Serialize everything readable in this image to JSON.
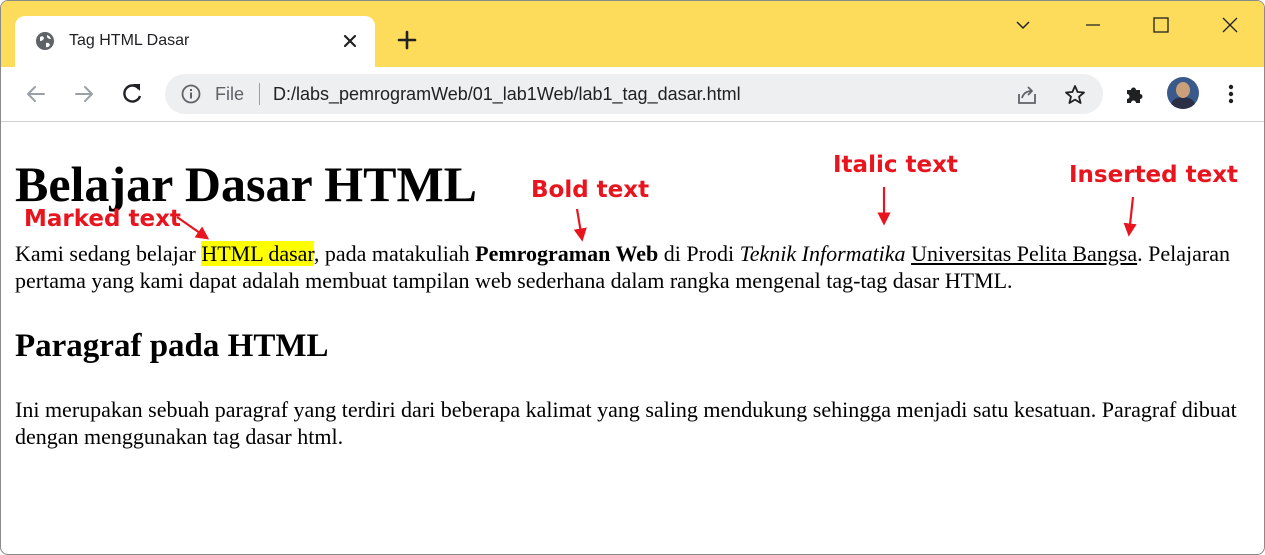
{
  "browser": {
    "tab_title": "Tag HTML Dasar",
    "file_label": "File",
    "url": "D:/labs_pemrogramWeb/01_lab1Web/lab1_tag_dasar.html",
    "titlebar_color": "#fcdc5a"
  },
  "page": {
    "heading1": "Belajar Dasar HTML",
    "para1": {
      "t1": "Kami sedang belajar ",
      "mark": "HTML dasar",
      "t2": ", pada matakuliah ",
      "bold": "Pemrograman Web",
      "t3": " di Prodi ",
      "italic": "Teknik Informatika",
      "t4": " ",
      "ins": "Universitas Pelita Bangsa",
      "t5": ". Pelajaran pertama yang kami dapat adalah membuat tampilan web sederhana dalam rangka mengenal tag-tag dasar HTML."
    },
    "heading2": "Paragraf pada HTML",
    "para2": "Ini merupakan sebuah paragraf yang terdiri dari beberapa kalimat yang saling mendukung sehingga menjadi satu kesatuan. Paragraf dibuat dengan menggunakan tag dasar html."
  },
  "annotations": {
    "marked": "Marked text",
    "bold": "Bold text",
    "italic": "Italic text",
    "inserted": "Inserted text",
    "color": "#e8141e"
  }
}
